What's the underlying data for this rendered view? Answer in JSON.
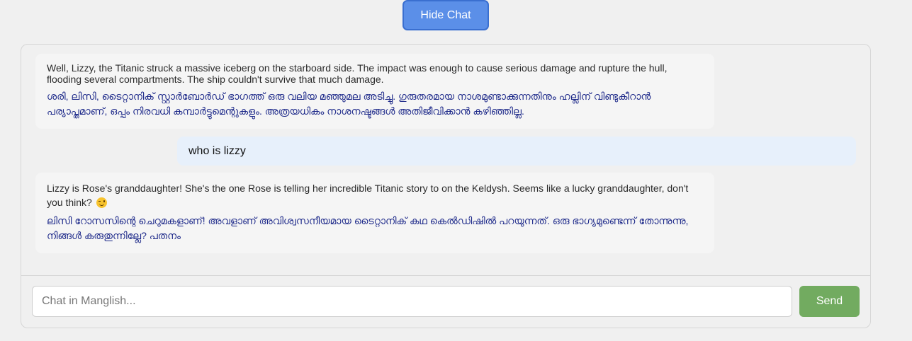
{
  "header": {
    "toggle_label": "Hide Chat"
  },
  "messages": [
    {
      "role": "bot",
      "english": "Well, Lizzy, the Titanic struck a massive iceberg on the starboard side. The impact was enough to cause serious damage and rupture the hull, flooding several compartments. The ship couldn't survive that much damage.",
      "malayalam": "ശരി, ലിസി, ടൈറ്റാനിക് സ്റ്റാർബോർഡ് ഭാഗത്ത് ഒരു വലിയ മഞ്ഞുമല അടിച്ചു. ഗുരുതരമായ നാശമുണ്ടാക്കുന്നതിനും ഹല്ലിന് വിണ്ടുകീറാൻ പര്യാപ്തമാണ്, ഒപ്പം നിരവധി കമ്പാർട്ടുമെന്റുകളും. അത്രയധികം നാശനഷ്ടങ്ങൾ അതിജീവിക്കാൻ കഴിഞ്ഞില്ല."
    },
    {
      "role": "user",
      "text": "who is lizzy"
    },
    {
      "role": "bot",
      "english": "Lizzy is Rose's granddaughter! She's the one Rose is telling her incredible Titanic story to on the Keldysh. Seems like a lucky granddaughter, don't you think?",
      "emoji": "winking-face",
      "malayalam": "ലിസി റോസസിന്റെ ചെറുമകളാണ്! അവളാണ് അവിശ്വസനീയമായ ടൈറ്റാനിക് കഥ കെൽഡിഷിൽ പറയുന്നത്. ഒരു ഭാഗ്യമുണ്ടെന്ന് തോന്നുന്നു, നിങ്ങൾ കരുതുന്നില്ലേ? പതനം"
    }
  ],
  "composer": {
    "placeholder": "Chat in Manglish...",
    "value": "",
    "send_label": "Send"
  },
  "colors": {
    "toggle_button": "#5b8fe8",
    "send_button": "#72ab60",
    "user_bubble": "#e7f0fb",
    "bot_bubble": "#f5f5f5",
    "malayalam_text": "#1e2a8a"
  }
}
